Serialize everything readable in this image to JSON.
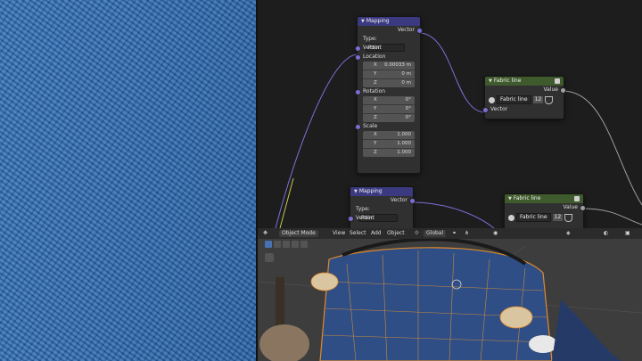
{
  "node_editor": {
    "mapping1": {
      "title": "Mapping",
      "output": "Vector",
      "type_label": "Type:",
      "type_value": "Point",
      "vector_label": "Vector",
      "location_label": "Location",
      "location": [
        {
          "axis": "X",
          "value": "0.00033 m"
        },
        {
          "axis": "Y",
          "value": "0 m"
        },
        {
          "axis": "Z",
          "value": "0 m"
        }
      ],
      "rotation_label": "Rotation",
      "rotation": [
        {
          "axis": "X",
          "value": "0°"
        },
        {
          "axis": "Y",
          "value": "0°"
        },
        {
          "axis": "Z",
          "value": "0°"
        }
      ],
      "scale_label": "Scale",
      "scale": [
        {
          "axis": "X",
          "value": "1.000"
        },
        {
          "axis": "Y",
          "value": "1.000"
        },
        {
          "axis": "Z",
          "value": "1.000"
        }
      ]
    },
    "mapping2": {
      "title": "Mapping",
      "output": "Vector",
      "type_label": "Type:",
      "type_value": "Point",
      "vector_label": "Vector"
    },
    "fabric1": {
      "title": "Fabric line",
      "output": "Value",
      "group_name": "Fabric line",
      "users": "12",
      "input": "Vector"
    },
    "fabric2": {
      "title": "Fabric line",
      "output": "Value",
      "group_name": "Fabric line",
      "users": "12"
    }
  },
  "viewport": {
    "mode": "Object Mode",
    "menus": [
      "View",
      "Select",
      "Add",
      "Object"
    ],
    "orientation": "Global"
  },
  "colors": {
    "mapping_header": "#3b3a80",
    "group_header": "#3f5a2c",
    "vector_socket": "#7a6fd6",
    "fabric_blue": "#3a73b2"
  }
}
